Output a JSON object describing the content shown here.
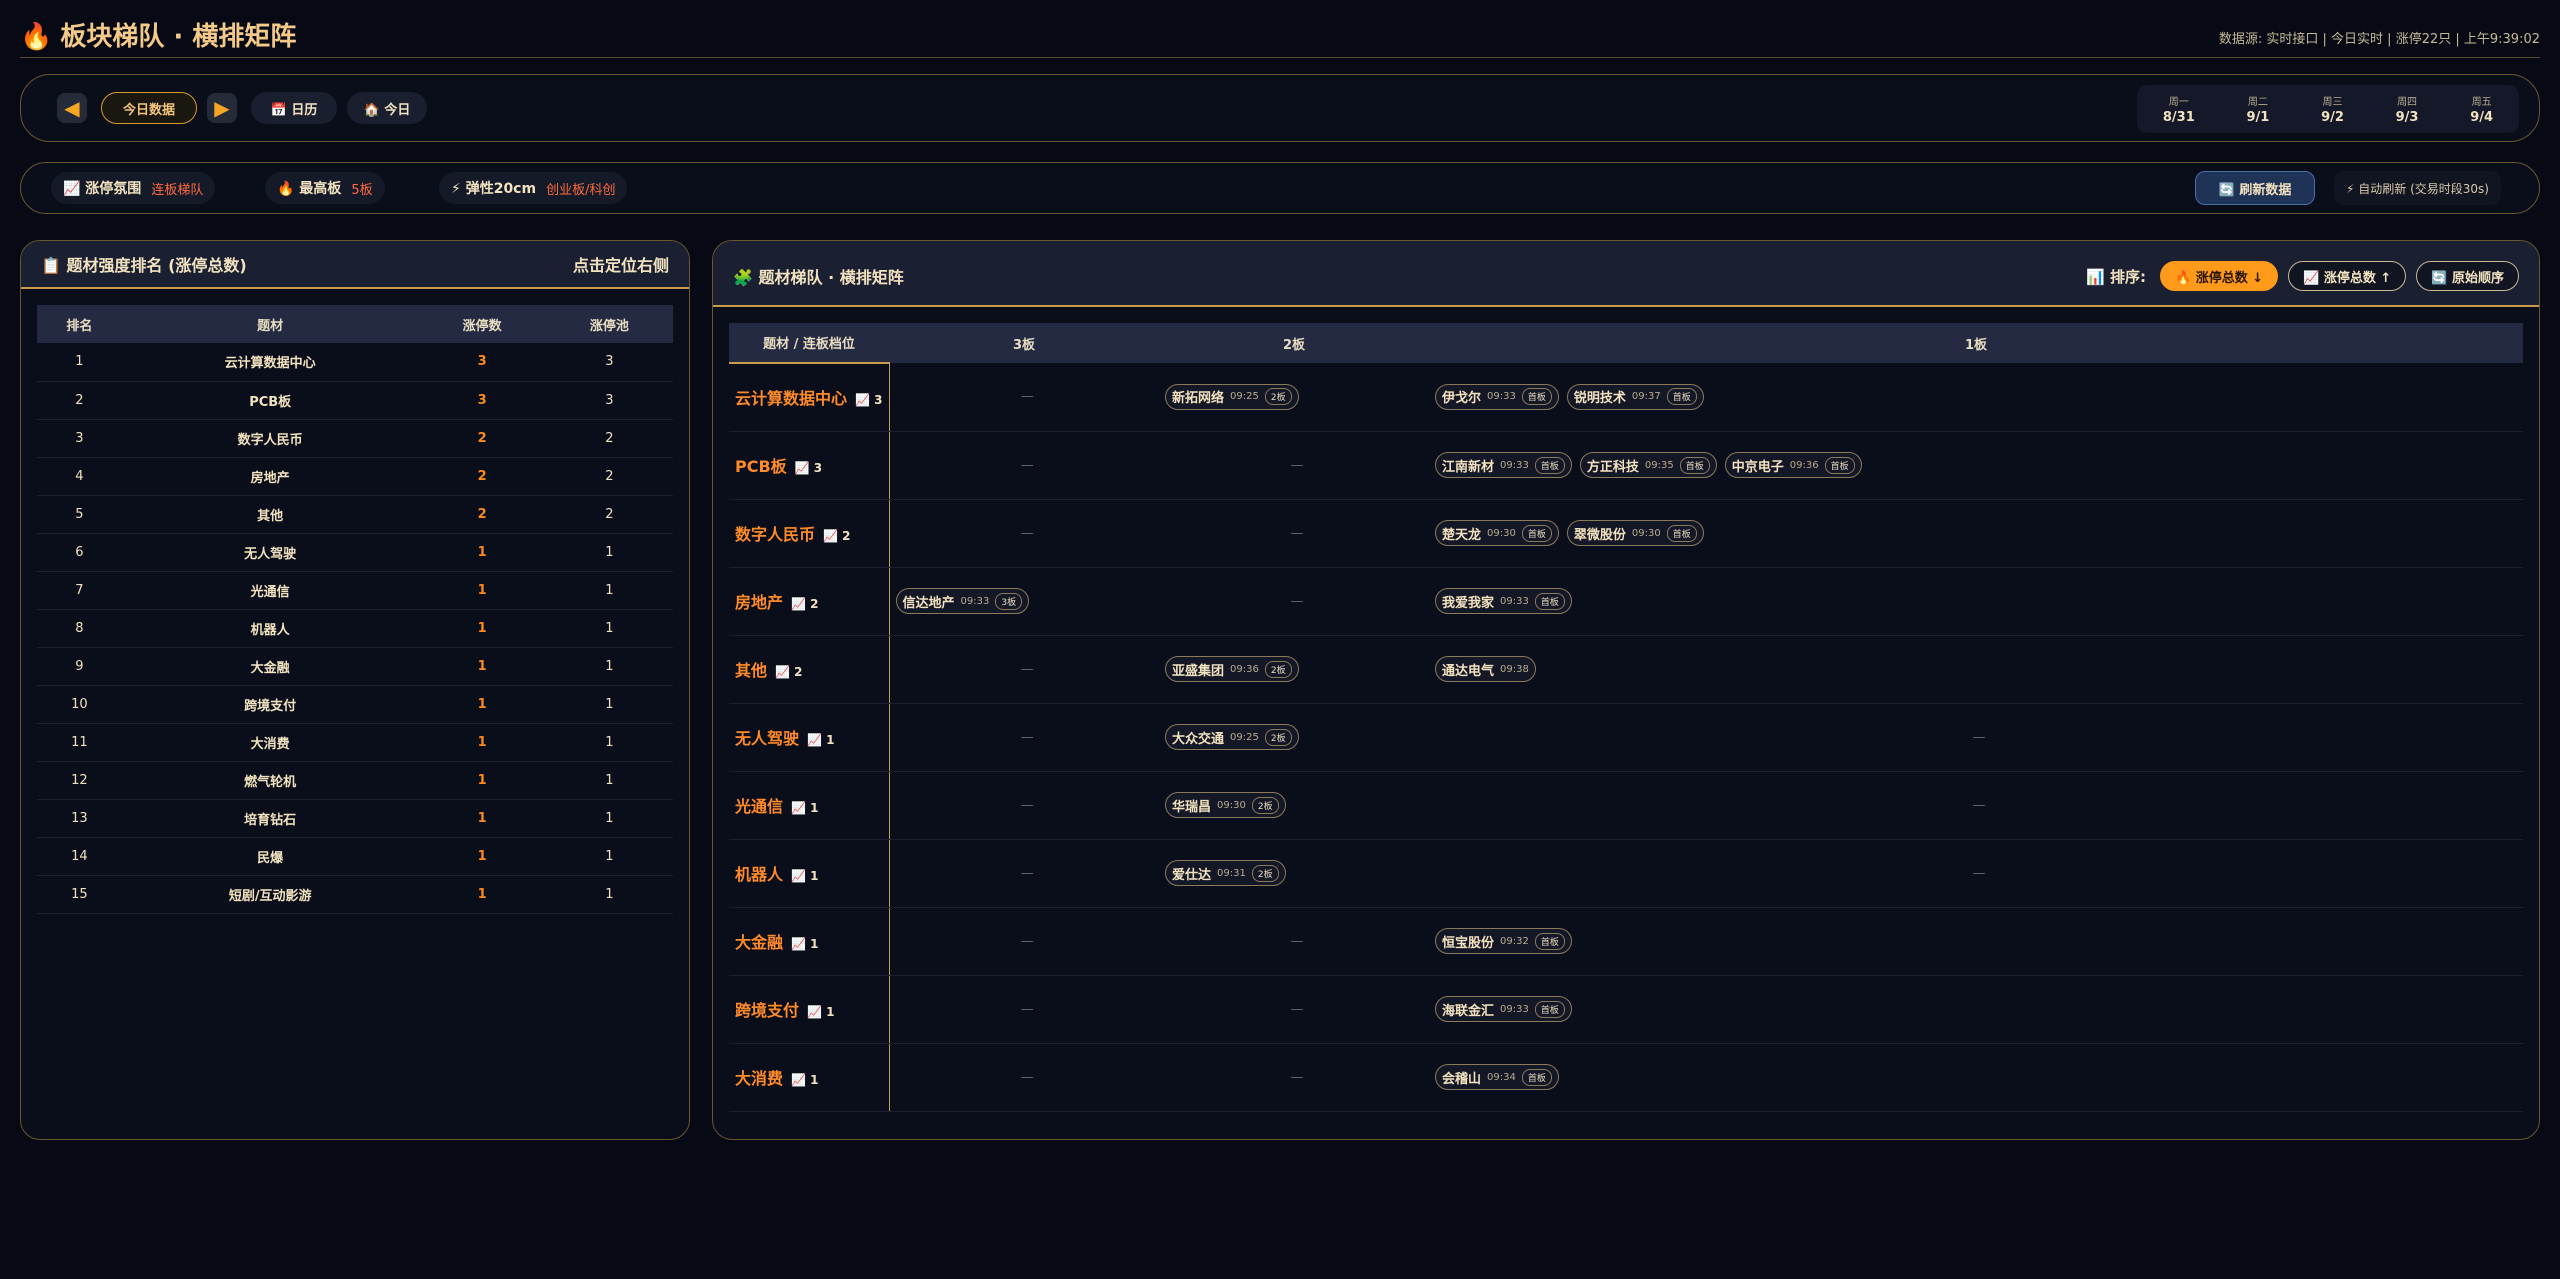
{
  "header": {
    "icon": "fire-icon",
    "title": "板块梯队 · 横排矩阵",
    "source": "数据源: 实时接口 | 今日实时 | 涨停22只 | 上午9:39:02"
  },
  "nav": {
    "prev_icon": "triangle-left-icon",
    "today_data": "今日数据",
    "next_icon": "triangle-right-icon",
    "calendar": "📅 日历",
    "today": "🏠 今日",
    "week": [
      {
        "day": "周一",
        "date": "8/31"
      },
      {
        "day": "周二",
        "date": "9/1"
      },
      {
        "day": "周三",
        "date": "9/2"
      },
      {
        "day": "周四",
        "date": "9/3"
      },
      {
        "day": "周五",
        "date": "9/4"
      }
    ]
  },
  "filters": {
    "scope_label": "📈 涨停氛围",
    "scope_value": "连板梯队",
    "high_label": "🔥 最高板",
    "high_value": "5板",
    "elastic_label": "⚡ 弹性20cm",
    "elastic_value": "创业板/科创",
    "refresh": "🔄 刷新数据",
    "auto": "⚡ 自动刷新 (交易时段30s)"
  },
  "left_panel": {
    "title": "📋 题材强度排名 (涨停总数)",
    "action": "点击定位右侧",
    "columns": [
      "排名",
      "题材",
      "涨停数",
      "涨停池"
    ],
    "rows": [
      {
        "rank": "1",
        "topic": "云计算数据中心",
        "count": "3",
        "pool": "3"
      },
      {
        "rank": "2",
        "topic": "PCB板",
        "count": "3",
        "pool": "3"
      },
      {
        "rank": "3",
        "topic": "数字人民币",
        "count": "2",
        "pool": "2"
      },
      {
        "rank": "4",
        "topic": "房地产",
        "count": "2",
        "pool": "2"
      },
      {
        "rank": "5",
        "topic": "其他",
        "count": "2",
        "pool": "2"
      },
      {
        "rank": "6",
        "topic": "无人驾驶",
        "count": "1",
        "pool": "1"
      },
      {
        "rank": "7",
        "topic": "光通信",
        "count": "1",
        "pool": "1"
      },
      {
        "rank": "8",
        "topic": "机器人",
        "count": "1",
        "pool": "1"
      },
      {
        "rank": "9",
        "topic": "大金融",
        "count": "1",
        "pool": "1"
      },
      {
        "rank": "10",
        "topic": "跨境支付",
        "count": "1",
        "pool": "1"
      },
      {
        "rank": "11",
        "topic": "大消费",
        "count": "1",
        "pool": "1"
      },
      {
        "rank": "12",
        "topic": "燃气轮机",
        "count": "1",
        "pool": "1"
      },
      {
        "rank": "13",
        "topic": "培育钻石",
        "count": "1",
        "pool": "1"
      },
      {
        "rank": "14",
        "topic": "民爆",
        "count": "1",
        "pool": "1"
      },
      {
        "rank": "15",
        "topic": "短剧/互动影游",
        "count": "1",
        "pool": "1"
      }
    ]
  },
  "right_panel": {
    "title": "🧩 题材梯队 · 横排矩阵",
    "sort_label": "📊 排序:",
    "sort_buttons": [
      "🔥 涨停总数 ↓",
      "📈 涨停总数 ↑",
      "🔄 原始顺序"
    ],
    "columns": [
      "题材 / 连板档位",
      "3板",
      "2板",
      "1板"
    ],
    "rows": [
      {
        "topic": "云计算数据中心",
        "badge": "📈 3",
        "b3": [],
        "b2": [
          {
            "name": "新拓网络",
            "time": "09:25",
            "tag": "2板"
          }
        ],
        "b1": [
          {
            "name": "伊戈尔",
            "time": "09:33",
            "tag": "首板"
          },
          {
            "name": "锐明技术",
            "time": "09:37",
            "tag": "首板"
          }
        ]
      },
      {
        "topic": "PCB板",
        "badge": "📈 3",
        "b3": [],
        "b2": [],
        "b1": [
          {
            "name": "江南新材",
            "time": "09:33",
            "tag": "首板"
          },
          {
            "name": "方正科技",
            "time": "09:35",
            "tag": "首板"
          },
          {
            "name": "中京电子",
            "time": "09:36",
            "tag": "首板"
          }
        ]
      },
      {
        "topic": "数字人民币",
        "badge": "📈 2",
        "b3": [],
        "b2": [],
        "b1": [
          {
            "name": "楚天龙",
            "time": "09:30",
            "tag": "首板"
          },
          {
            "name": "翠微股份",
            "time": "09:30",
            "tag": "首板"
          }
        ]
      },
      {
        "topic": "房地产",
        "badge": "📈 2",
        "b3": [
          {
            "name": "信达地产",
            "time": "09:33",
            "tag": "3板"
          }
        ],
        "b2": [],
        "b1": [
          {
            "name": "我爱我家",
            "time": "09:33",
            "tag": "首板"
          }
        ]
      },
      {
        "topic": "其他",
        "badge": "📈 2",
        "b3": [],
        "b2": [
          {
            "name": "亚盛集团",
            "time": "09:36",
            "tag": "2板"
          }
        ],
        "b1": [
          {
            "name": "通达电气",
            "time": "09:38",
            "tag": ""
          }
        ]
      },
      {
        "topic": "无人驾驶",
        "badge": "📈 1",
        "b3": [],
        "b2": [
          {
            "name": "大众交通",
            "time": "09:25",
            "tag": "2板"
          }
        ],
        "b1": []
      },
      {
        "topic": "光通信",
        "badge": "📈 1",
        "b3": [],
        "b2": [
          {
            "name": "华瑞昌",
            "time": "09:30",
            "tag": "2板"
          }
        ],
        "b1": []
      },
      {
        "topic": "机器人",
        "badge": "📈 1",
        "b3": [],
        "b2": [
          {
            "name": "爱仕达",
            "time": "09:31",
            "tag": "2板"
          }
        ],
        "b1": []
      },
      {
        "topic": "大金融",
        "badge": "📈 1",
        "b3": [],
        "b2": [],
        "b1": [
          {
            "name": "恒宝股份",
            "time": "09:32",
            "tag": "首板"
          }
        ]
      },
      {
        "topic": "跨境支付",
        "badge": "📈 1",
        "b3": [],
        "b2": [],
        "b1": [
          {
            "name": "海联金汇",
            "time": "09:33",
            "tag": "首板"
          }
        ]
      },
      {
        "topic": "大消费",
        "badge": "📈 1",
        "b3": [],
        "b2": [],
        "b1": [
          {
            "name": "会稽山",
            "time": "09:34",
            "tag": "首板"
          }
        ]
      }
    ],
    "empty_mark": "—"
  }
}
